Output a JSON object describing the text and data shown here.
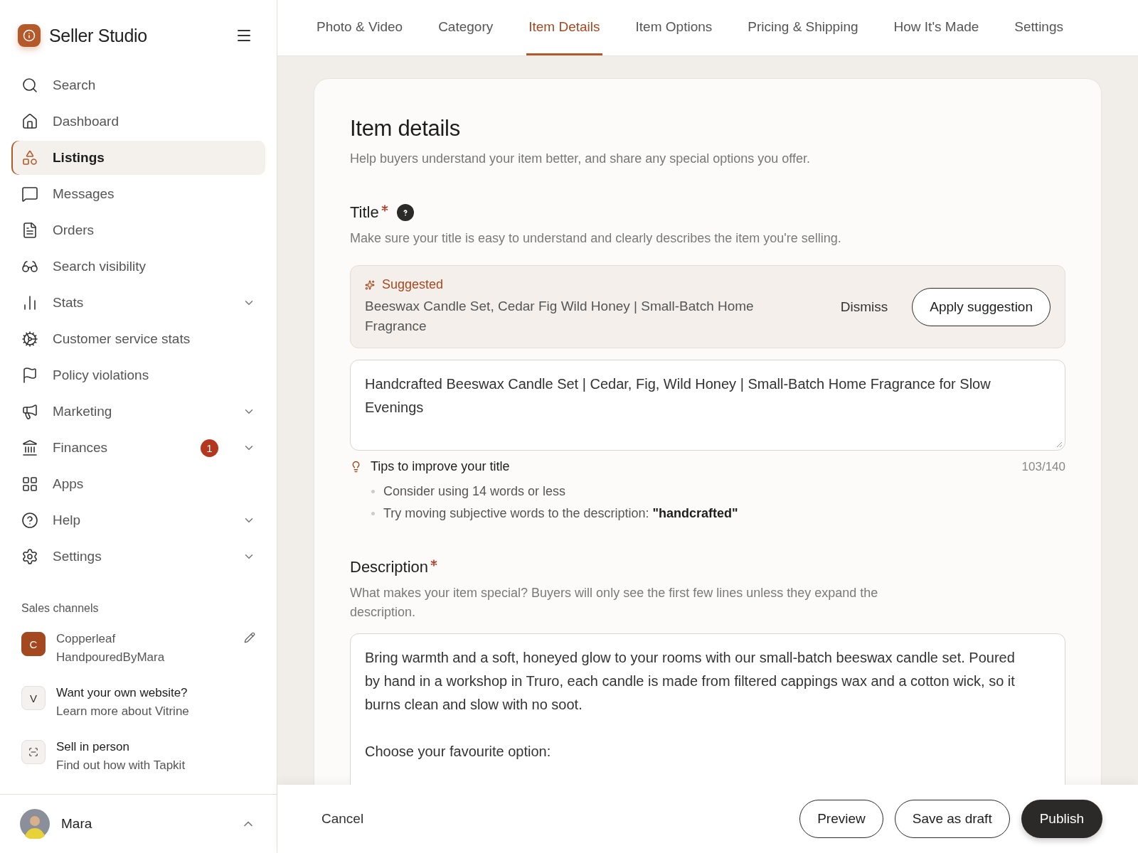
{
  "app": {
    "name": "Seller Studio"
  },
  "sidebar": {
    "items": [
      {
        "label": "Search",
        "kind": "link",
        "selected": false
      },
      {
        "label": "Dashboard",
        "kind": "link",
        "selected": false
      },
      {
        "label": "Listings",
        "kind": "link",
        "selected": true
      },
      {
        "label": "Messages",
        "kind": "link",
        "selected": false
      },
      {
        "label": "Orders",
        "kind": "link",
        "selected": false
      },
      {
        "label": "Search visibility",
        "kind": "link",
        "selected": false
      },
      {
        "label": "Stats",
        "kind": "group",
        "selected": false,
        "expanded": false
      },
      {
        "label": "Customer service stats",
        "kind": "link",
        "selected": false
      },
      {
        "label": "Policy violations",
        "kind": "link",
        "selected": false
      },
      {
        "label": "Marketing",
        "kind": "group",
        "selected": false,
        "expanded": false
      },
      {
        "label": "Finances",
        "kind": "group",
        "selected": false,
        "expanded": false,
        "badge": "1"
      },
      {
        "label": "Apps",
        "kind": "link",
        "selected": false
      },
      {
        "label": "Help",
        "kind": "group",
        "selected": false,
        "expanded": false
      },
      {
        "label": "Settings",
        "kind": "group",
        "selected": false,
        "expanded": false
      }
    ],
    "sales_channels": {
      "heading": "Sales channels",
      "items": [
        {
          "kind": "shop",
          "initial": "C",
          "title": "Copperleaf",
          "subtitle": "HandpouredByMara"
        },
        {
          "kind": "promo",
          "initial": "V",
          "title": "Want your own website?",
          "subtitle": "Learn more about Vitrine"
        },
        {
          "kind": "promo",
          "title": "Sell in person",
          "subtitle": "Find out how with Tapkit"
        }
      ]
    },
    "user": {
      "name": "Mara",
      "expanded": true
    }
  },
  "tabs": [
    {
      "label": "Photo & Video",
      "selected": false
    },
    {
      "label": "Category",
      "selected": false
    },
    {
      "label": "Item Details",
      "selected": true
    },
    {
      "label": "Item Options",
      "selected": false
    },
    {
      "label": "Pricing & Shipping",
      "selected": false
    },
    {
      "label": "How It's Made",
      "selected": false
    },
    {
      "label": "Settings",
      "selected": false
    }
  ],
  "card": {
    "heading": "Item details",
    "subheading": "Help buyers understand your item better, and share any special options you offer.",
    "title_field": {
      "label": "Title",
      "required": true,
      "hint": "Make sure your title is easy to understand and clearly describes the item you're selling.",
      "suggestion": {
        "label": "Suggested",
        "text": "Beeswax Candle Set, Cedar Fig Wild Honey | Small-Batch Home Fragrance",
        "dismiss": "Dismiss",
        "apply": "Apply suggestion"
      },
      "value": "Handcrafted Beeswax Candle Set | Cedar, Fig, Wild Honey | Small-Batch Home Fragrance for Slow Evenings",
      "tips_heading": "Tips to improve your title",
      "count": "103/140",
      "tips": [
        "Consider using 14 words or less",
        "Try moving subjective words to the description: **\"handcrafted\"**"
      ]
    },
    "description_field": {
      "label": "Description",
      "required": true,
      "hint": "What makes your item special? Buyers will only see the first few lines unless they expand the description.",
      "paragraphs": [
        "Bring warmth and a soft, honeyed glow to your rooms with our small-batch beeswax candle set. Poured by hand in a workshop in Truro, each candle is made from filtered cappings wax and a cotton wick, so it burns clean and slow with no soot.",
        "Choose your favourite option:"
      ]
    }
  },
  "footer": {
    "cancel": "Cancel",
    "buttons": [
      "Preview",
      "Save as draft"
    ],
    "primary": "Publish"
  }
}
